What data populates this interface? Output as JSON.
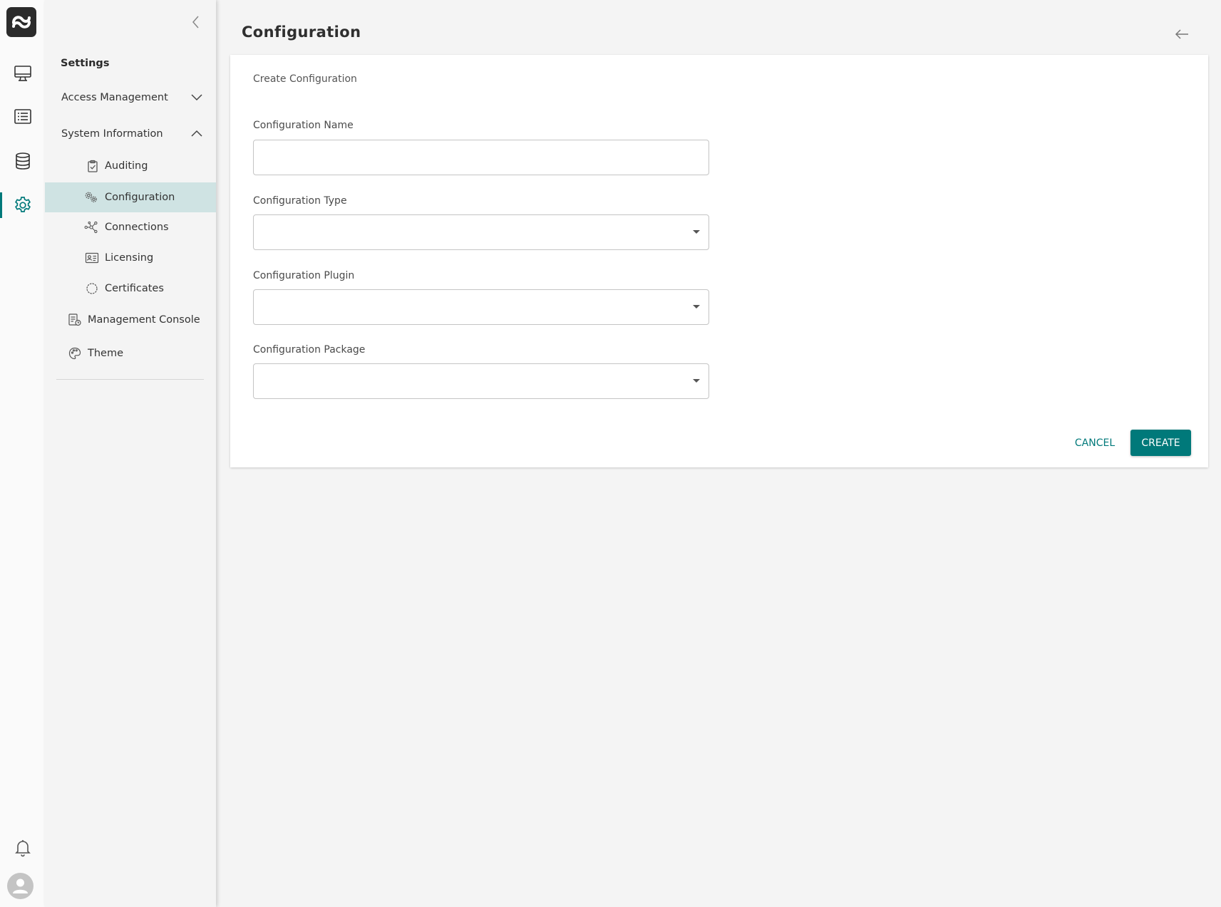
{
  "page": {
    "title": "Configuration"
  },
  "sidebar": {
    "title": "Settings",
    "sections": [
      {
        "label": "Access Management",
        "expanded": false
      },
      {
        "label": "System Information",
        "expanded": true
      }
    ],
    "system_items": [
      {
        "label": "Auditing",
        "icon": "clipboard-check-icon"
      },
      {
        "label": "Configuration",
        "icon": "gears-icon",
        "selected": true
      },
      {
        "label": "Connections",
        "icon": "network-icon"
      },
      {
        "label": "Licensing",
        "icon": "id-card-icon"
      },
      {
        "label": "Certificates",
        "icon": "certificate-badge-icon"
      }
    ],
    "other_items": [
      {
        "label": "Management Console",
        "icon": "console-doc-icon"
      },
      {
        "label": "Theme",
        "icon": "palette-icon"
      }
    ]
  },
  "rail": {
    "items": [
      "monitor-icon",
      "list-icon",
      "database-icon",
      "gear-icon"
    ],
    "active": "gear-icon",
    "bottom": [
      "bell-icon",
      "user-avatar-icon"
    ]
  },
  "form": {
    "subtitle": "Create Configuration",
    "fields": [
      {
        "label": "Configuration Name",
        "type": "text",
        "value": ""
      },
      {
        "label": "Configuration Type",
        "type": "select",
        "value": ""
      },
      {
        "label": "Configuration Plugin",
        "type": "select",
        "value": ""
      },
      {
        "label": "Configuration Package",
        "type": "select",
        "value": ""
      }
    ],
    "cancel_label": "CANCEL",
    "create_label": "CREATE"
  },
  "colors": {
    "accent": "#00797a",
    "selected_bg": "#cfe3e3",
    "background": "#f4f4f4"
  }
}
